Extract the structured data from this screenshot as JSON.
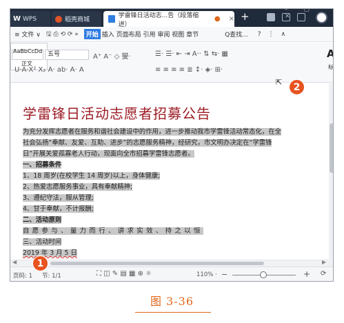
{
  "titlebar": {
    "tab_wps": "WPS",
    "tab_store": "稻壳商城",
    "tab_doc": "学雷锋日活动志...告（段落缩进）",
    "tab_doc_close": "×",
    "new_tab": "+"
  },
  "menu": {
    "file": "≡ 文件 ∨",
    "quick_tools": "🖫 ⎙ ⟲ ⟳ »",
    "start": "开始",
    "items": "插入 页面布局 引用 审阅 视图 章节",
    "find": "Q查找...",
    "help": "?",
    "more": "⋮",
    "collapse": "∧"
  },
  "ribbon": {
    "font_name": "",
    "font_size": "五号",
    "row1_tools": "A⁺ A⁻ ◇ 燮·",
    "row2_tools": "U·A·X² X₂ A· ab· A· A",
    "para_row1": "☰· ☰· ⇤ ⇥ A·· ⇅ ⇆· ▦",
    "para_row2": "≡ ≡ ≡ ≡ ≣ ↕· ◈· ⊞·",
    "style_a_sample": "AaBbCcDd",
    "style_a_name": "正文",
    "style_b_sample": "A",
    "style_b_name": "标"
  },
  "document": {
    "title": "学雷锋日活动志愿者招募公告",
    "lines": [
      "为充分发挥志愿者在服务和谐社会建设中的作用，进一步推动我市学雷锋活动常态化，在全",
      "社会弘扬“奉献、友爱、互助、进步”的志愿服务精神，经研究，市文明办决定在“学雷锋",
      "日”开展关爱孤寡老人行动，现面向全市招募学雷锋志愿者。",
      "一、招募条件",
      "1、18 周岁(在校学生 14 周岁)以上，身体健康;",
      "2、热爱志愿服务事业，具有奉献精神;",
      "3、遵纪守法，服从管理;",
      "4、甘于奉献，不计报酬;",
      "二、活动原则",
      "自愿参与、量力而行、讲求实效、持之以恒",
      "三、活动时间",
      "2019 年 3 月 5 日"
    ]
  },
  "status": {
    "page": "页码: 1",
    "sections": "节: 1/1",
    "icons": "⛶ ◫ ✎ ▤ ▦ ⊕ ☼",
    "zoom": "110% ·",
    "zoom_minus": "−",
    "zoom_plus": "+",
    "fit": "⟳"
  },
  "callouts": {
    "one": "1",
    "two": "2"
  },
  "caption": "图 3-36"
}
